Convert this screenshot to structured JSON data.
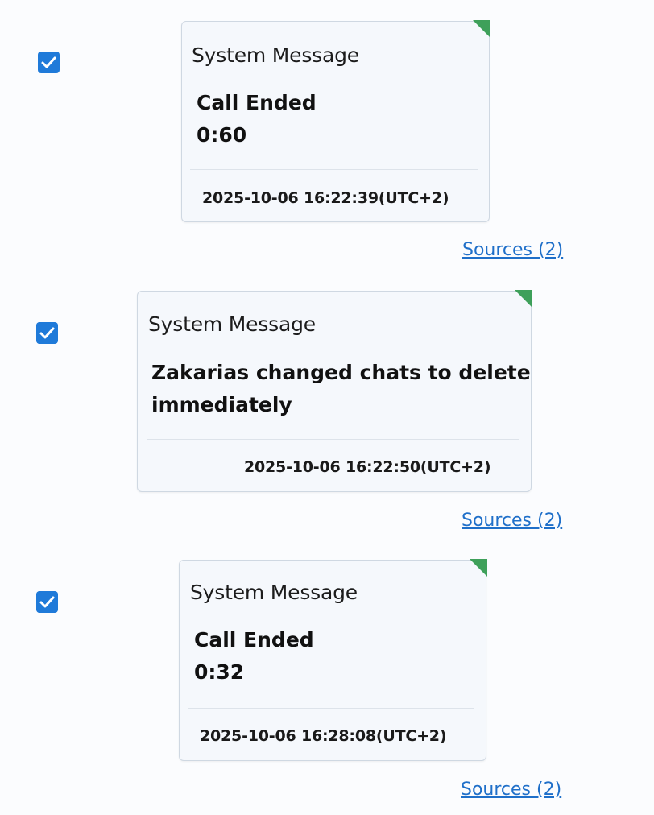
{
  "colors": {
    "checkbox": "#1f7ad9",
    "read_marker": "#3ea05a",
    "link": "#1f6fc9"
  },
  "messages": [
    {
      "checked": true,
      "sender": "System Message",
      "body_lines": [
        "Call Ended",
        "0:60"
      ],
      "timestamp": "2025-10-06 16:22:39(UTC+2)",
      "sources_label": "Sources (2)"
    },
    {
      "checked": true,
      "sender": "System Message",
      "body_lines": [
        "Zakarias changed chats to delete",
        "immediately"
      ],
      "timestamp": "2025-10-06 16:22:50(UTC+2)",
      "sources_label": "Sources (2)"
    },
    {
      "checked": true,
      "sender": "System Message",
      "body_lines": [
        "Call Ended",
        "0:32"
      ],
      "timestamp": "2025-10-06 16:28:08(UTC+2)",
      "sources_label": "Sources (2)"
    }
  ]
}
